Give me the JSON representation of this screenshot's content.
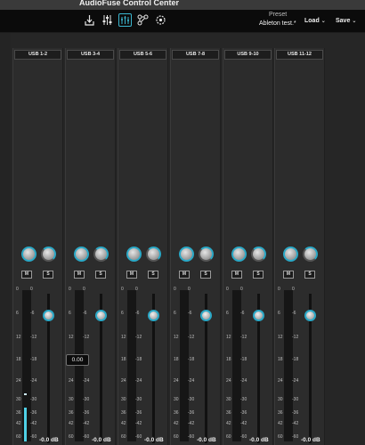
{
  "window": {
    "title": "AudioFuse Control Center"
  },
  "toolbar": {
    "icons": [
      "input-icon",
      "eq-icon",
      "mixer-icon",
      "routing-icon",
      "settings-icon"
    ],
    "active_icon": "mixer-icon",
    "preset_label": "Preset",
    "preset_name": "Ableton test.*",
    "load_label": "Load",
    "save_label": "Save"
  },
  "accent_color": "#2aa8c6",
  "strips": [
    {
      "name": "USB 1-2",
      "mute": "M",
      "solo": "S",
      "gain_db": "-0.0 dB"
    },
    {
      "name": "USB 3-4",
      "mute": "M",
      "solo": "S",
      "gain_db": "-0.0 dB"
    },
    {
      "name": "USB 5-6",
      "mute": "M",
      "solo": "S",
      "gain_db": "-0.0 dB"
    },
    {
      "name": "USB 7-8",
      "mute": "M",
      "solo": "S",
      "gain_db": "-0.0 dB"
    },
    {
      "name": "USB 9-10",
      "mute": "M",
      "solo": "S",
      "gain_db": "-0.0 dB"
    },
    {
      "name": "USB 11-12",
      "mute": "M",
      "solo": "S",
      "gain_db": "-0.0 dB"
    }
  ],
  "meter_scale_left": [
    "0",
    "6",
    "12",
    "18",
    "24",
    "30",
    "36",
    "42",
    "60"
  ],
  "meter_scale_right": [
    "0",
    "-6",
    "-12",
    "-18",
    "-24",
    "-30",
    "-36",
    "-42",
    "-60"
  ],
  "tooltip_value": "0.00"
}
